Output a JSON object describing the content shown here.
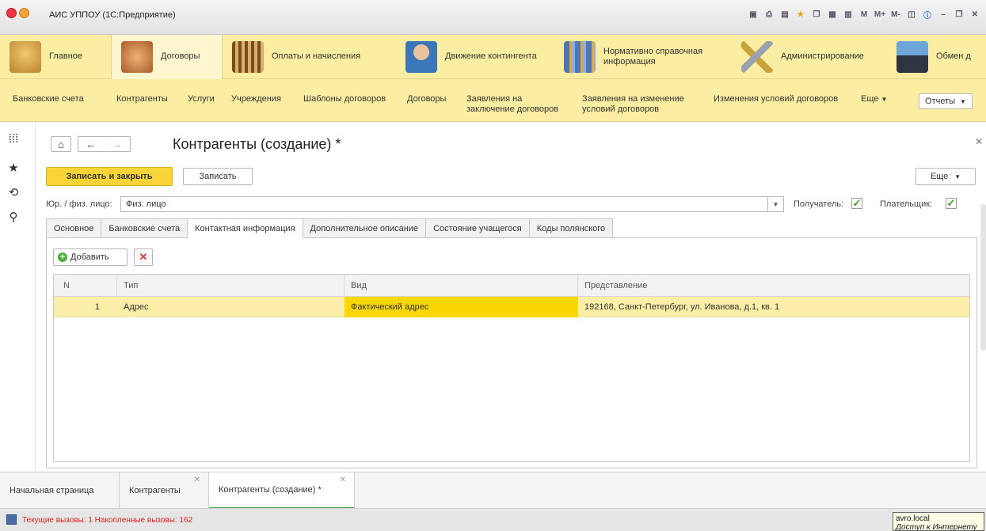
{
  "window": {
    "title": "АИС УППОУ  (1С:Предприятие)"
  },
  "title_icons": [
    "save-icon",
    "print-icon",
    "preview-icon",
    "favorites-icon",
    "copy-icon",
    "calculator-icon",
    "calendar-icon"
  ],
  "title_memory": {
    "m": "M",
    "m_plus": "M+",
    "m_minus": "M-"
  },
  "sections": [
    {
      "label": "Главное",
      "icon": "desk-icon",
      "color": "#d9a84a"
    },
    {
      "label": "Договоры",
      "icon": "handshake-icon",
      "color": "#c77a3d"
    },
    {
      "label": "Оплаты и начисления",
      "icon": "abacus-icon",
      "color": "#8b5a2b"
    },
    {
      "label": "Движение контингента",
      "icon": "person-icon",
      "color": "#3a76b8"
    },
    {
      "label": "Нормативно справочная информация",
      "icon": "books-icon",
      "color": "#6b8fc7"
    },
    {
      "label": "Администрирование",
      "icon": "tools-icon",
      "color": "#9aa3ad"
    },
    {
      "label": "Обмен д",
      "icon": "exchange-icon",
      "color": "#4a5a7a"
    }
  ],
  "subnav": {
    "items": [
      "Банковские счета",
      "Контрагенты",
      "Услуги",
      "Учреждения",
      "Шаблоны договоров",
      "Договоры"
    ],
    "item_twoline_1": [
      "Заявления на",
      "заключение договоров"
    ],
    "item_twoline_2": [
      "Заявления на изменение",
      "условий договоров"
    ],
    "item_changes": "Изменения условий договоров",
    "more": "Еще",
    "reports": "Отчеты"
  },
  "form": {
    "title": "Контрагенты (создание) *",
    "save_close": "Записать и закрыть",
    "save": "Записать",
    "more": "Еще",
    "entity_label": "Юр. / физ. лицо:",
    "entity_value": "Физ. лицо",
    "recipient_label": "Получатель:",
    "payer_label": "Плательщик:",
    "recipient_checked": true,
    "payer_checked": true
  },
  "tabs": [
    "Основное",
    "Банковские счета",
    "Контактная информация",
    "Дополнительное описание",
    "Состояние учащегося",
    "Коды полянского"
  ],
  "active_tab": 2,
  "toolbar": {
    "add": "Добавить"
  },
  "table": {
    "headers": [
      "N",
      "Тип",
      "Вид",
      "Представление"
    ],
    "rows": [
      {
        "n": "1",
        "type": "Адрес",
        "kind": "Фактический адрес",
        "repr": "192168, Санкт-Петербург, ул. Иванова, д.1, кв. 1"
      }
    ]
  },
  "bottom_tabs": [
    "Начальная страница",
    "Контрагенты",
    "Контрагенты (создание) *"
  ],
  "status": {
    "text": "Текущие вызовы: 1   Накопленные вызовы: 162"
  },
  "tooltip": {
    "line1": "avro.local",
    "line2": "Доступ к Интернету"
  },
  "colors": {
    "panel_yellow": "#fbeda1",
    "primary_button": "#f8d437",
    "selected_row": "#fbefa8",
    "highlight_cell": "#fbd700",
    "check_green": "#3a9d23"
  }
}
